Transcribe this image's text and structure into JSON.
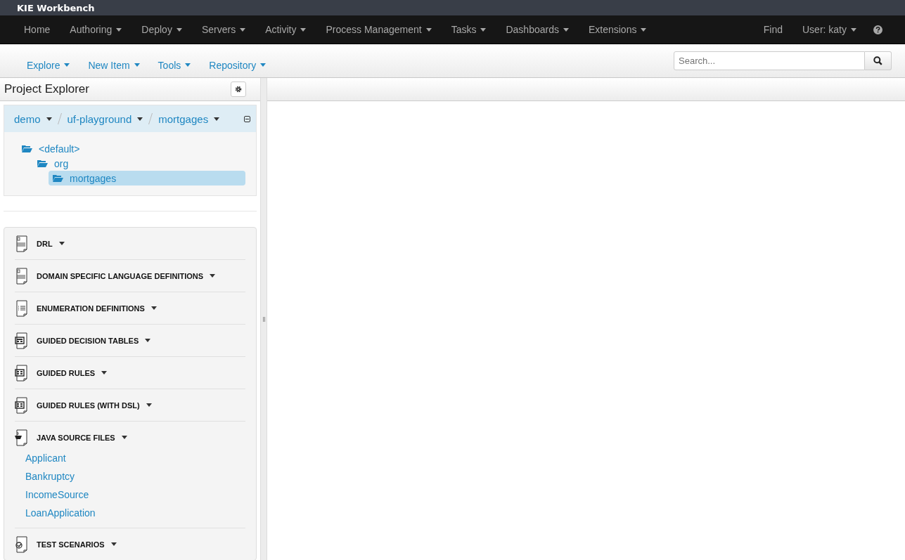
{
  "brand": "KIE Workbench",
  "nav": {
    "items": [
      {
        "label": "Home",
        "dropdown": false
      },
      {
        "label": "Authoring",
        "dropdown": true
      },
      {
        "label": "Deploy",
        "dropdown": true
      },
      {
        "label": "Servers",
        "dropdown": true
      },
      {
        "label": "Activity",
        "dropdown": true
      },
      {
        "label": "Process Management",
        "dropdown": true
      },
      {
        "label": "Tasks",
        "dropdown": true
      },
      {
        "label": "Dashboards",
        "dropdown": true
      },
      {
        "label": "Extensions",
        "dropdown": true
      }
    ],
    "right_items": [
      {
        "label": "Find",
        "dropdown": false
      },
      {
        "label": "User: katy",
        "dropdown": true
      }
    ]
  },
  "toolbar": {
    "menus": [
      "Explore",
      "New Item",
      "Tools",
      "Repository"
    ],
    "search": {
      "placeholder": "Search..."
    }
  },
  "explorer": {
    "title": "Project Explorer",
    "breadcrumbs": [
      "demo",
      "uf-playground",
      "mortgages"
    ],
    "tree": [
      {
        "label": "<default>",
        "selected": false,
        "children": [
          {
            "label": "org",
            "selected": false,
            "children": [
              {
                "label": "mortgages",
                "selected": true
              }
            ]
          }
        ]
      }
    ],
    "categories": [
      {
        "kind": "drl",
        "label": "DRL"
      },
      {
        "kind": "drl",
        "label": "DOMAIN SPECIFIC LANGUAGE DEFINITIONS"
      },
      {
        "kind": "enum",
        "label": "ENUMERATION DEFINITIONS"
      },
      {
        "kind": "table",
        "label": "GUIDED DECISION TABLES"
      },
      {
        "kind": "guided",
        "label": "GUIDED RULES"
      },
      {
        "kind": "guided",
        "label": "GUIDED RULES (WITH DSL)"
      },
      {
        "kind": "java",
        "label": "JAVA SOURCE FILES",
        "items": [
          "Applicant",
          "Bankruptcy",
          "IncomeSource",
          "LoanApplication"
        ]
      },
      {
        "kind": "test",
        "label": "TEST SCENARIOS"
      }
    ]
  }
}
